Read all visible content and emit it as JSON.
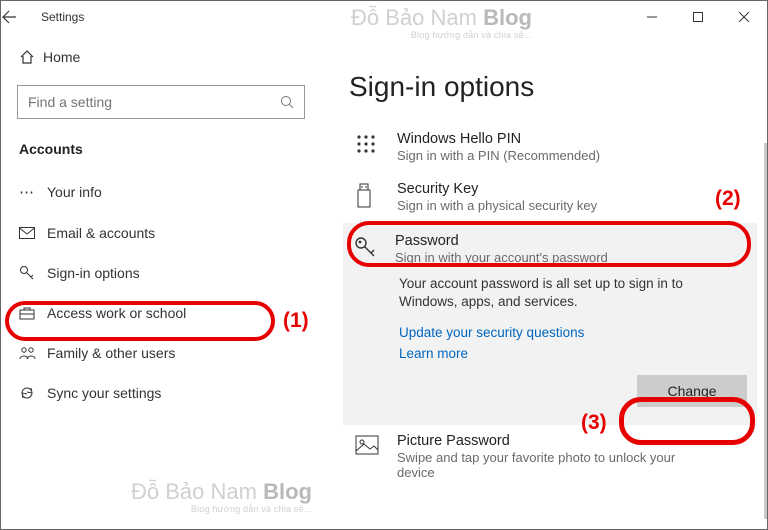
{
  "window": {
    "title": "Settings"
  },
  "sidebar": {
    "home": "Home",
    "search_placeholder": "Find a setting",
    "section": "Accounts",
    "items": [
      {
        "label": "Your info"
      },
      {
        "label": "Email & accounts"
      },
      {
        "label": "Sign-in options"
      },
      {
        "label": "Access work or school"
      },
      {
        "label": "Family & other users"
      },
      {
        "label": "Sync your settings"
      }
    ]
  },
  "page": {
    "title": "Sign-in options",
    "options": {
      "pin": {
        "title": "Windows Hello PIN",
        "desc": "Sign in with a PIN (Recommended)"
      },
      "seckey": {
        "title": "Security Key",
        "desc": "Sign in with a physical security key"
      },
      "password": {
        "title": "Password",
        "desc": "Sign in with your account's password",
        "detail": "Your account password is all set up to sign in to Windows, apps, and services.",
        "link1": "Update your security questions",
        "link2": "Learn more",
        "button": "Change"
      },
      "picture": {
        "title": "Picture Password",
        "desc": "Swipe and tap your favorite photo to unlock your device"
      }
    }
  },
  "annotations": {
    "a1": "(1)",
    "a2": "(2)",
    "a3": "(3)"
  },
  "watermark": {
    "text1": "Đỗ Bảo Nam ",
    "text2": "Blog",
    "sub": "Blog hướng dẫn và chia sẻ..."
  }
}
